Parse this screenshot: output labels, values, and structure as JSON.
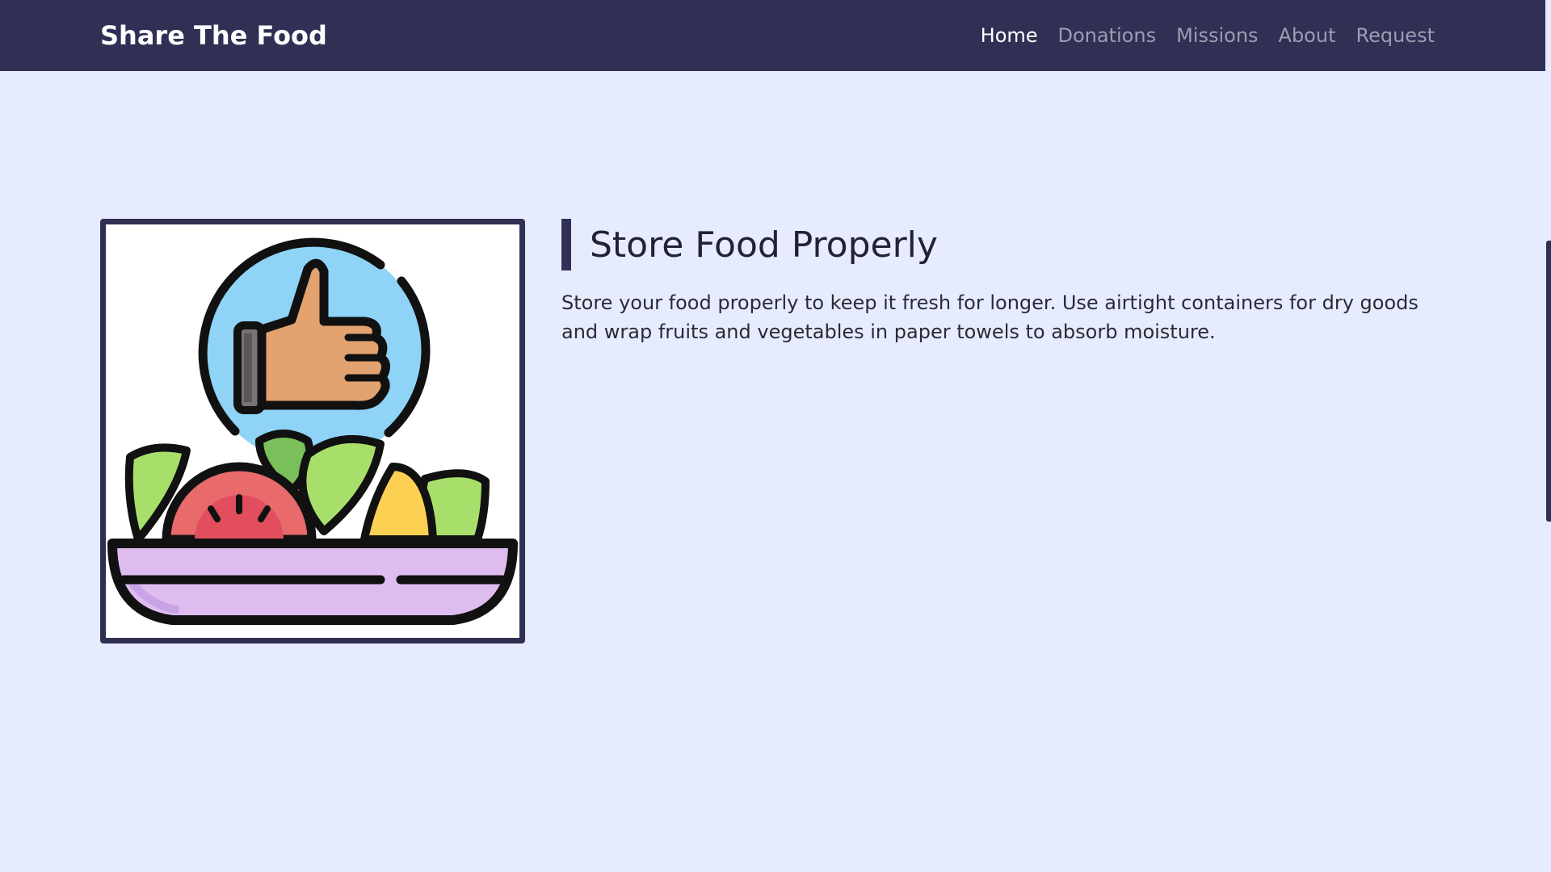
{
  "nav": {
    "brand": "Share The Food",
    "links": [
      {
        "label": "Home",
        "active": true
      },
      {
        "label": "Donations",
        "active": false
      },
      {
        "label": "Missions",
        "active": false
      },
      {
        "label": "About",
        "active": false
      },
      {
        "label": "Request",
        "active": false
      }
    ]
  },
  "feature": {
    "title": "Store Food Properly",
    "description": "Store your food properly to keep it fresh for longer. Use airtight containers for dry goods and wrap fruits and vegetables in paper towels to absorb moisture.",
    "image_icon": "salad-bowl-thumbs-up-icon"
  },
  "colors": {
    "navbar": "#302f54",
    "page_bg": "#e6ecfe",
    "active_link": "#ffffff",
    "inactive_link": "#9d9cb2"
  }
}
